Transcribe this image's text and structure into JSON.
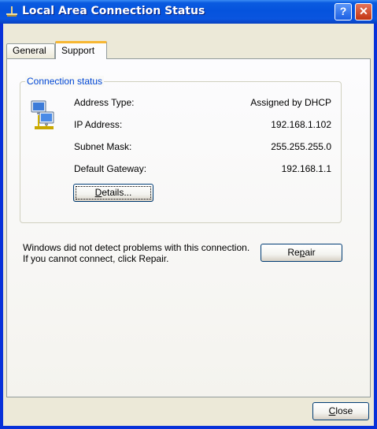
{
  "window": {
    "title": "Local Area Connection Status",
    "help_label": "?",
    "close_label": "✕"
  },
  "tabs": [
    {
      "label": "General",
      "selected": false
    },
    {
      "label": "Support",
      "selected": true
    }
  ],
  "connection_status": {
    "group_title": "Connection status",
    "rows": [
      {
        "label": "Address Type:",
        "value": "Assigned by DHCP"
      },
      {
        "label": "IP Address:",
        "value": "192.168.1.102"
      },
      {
        "label": "Subnet Mask:",
        "value": "255.255.255.0"
      },
      {
        "label": "Default Gateway:",
        "value": "192.168.1.1"
      }
    ],
    "details_button": {
      "pre": "",
      "accel": "D",
      "post": "etails..."
    }
  },
  "message": "Windows did not detect problems with this connection. If you cannot connect, click Repair.",
  "repair_button": {
    "pre": "Re",
    "accel": "p",
    "post": "air"
  },
  "close_button": {
    "pre": "",
    "accel": "C",
    "post": "lose"
  },
  "colors": {
    "titlebar": "#0553dd",
    "dialog_bg": "#ece9d8",
    "group_title": "#0046d5",
    "close_button": "#c23512",
    "tab_highlight": "#f7b733"
  }
}
